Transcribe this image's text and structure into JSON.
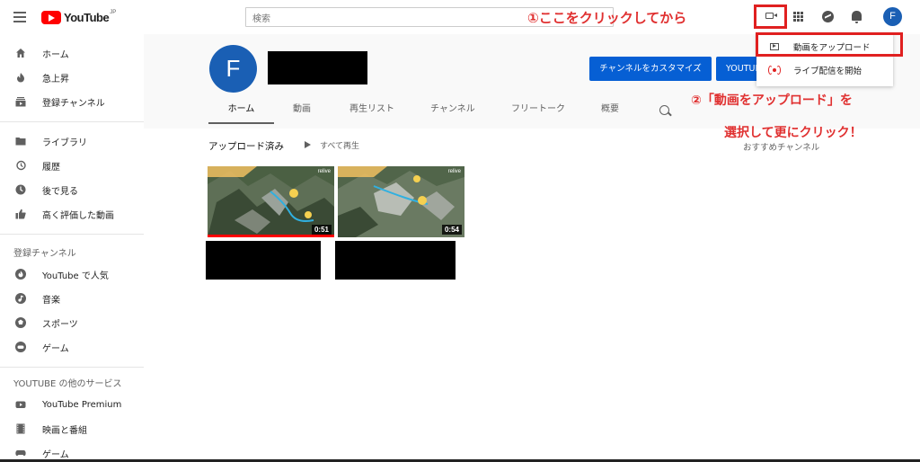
{
  "header": {
    "logo_text": "YouTube",
    "logo_region": "JP",
    "search_placeholder": "検索",
    "avatar_letter": "F",
    "annotation_step1": "①ここをクリックしてから"
  },
  "dropdown": {
    "items": [
      {
        "label": "動画をアップロード",
        "icon": "upload-video-icon"
      },
      {
        "label": "ライブ配信を開始",
        "icon": "go-live-icon"
      }
    ]
  },
  "annotation_step2": {
    "line1": "②「動画をアップロード」を",
    "line2": "選択して更にクリック！"
  },
  "sidebar": {
    "primary": [
      {
        "label": "ホーム",
        "icon": "home-icon"
      },
      {
        "label": "急上昇",
        "icon": "trending-icon"
      },
      {
        "label": "登録チャンネル",
        "icon": "subscriptions-icon"
      }
    ],
    "library": [
      {
        "label": "ライブラリ",
        "icon": "library-icon"
      },
      {
        "label": "履歴",
        "icon": "history-icon"
      },
      {
        "label": "後で見る",
        "icon": "watch-later-icon"
      },
      {
        "label": "高く評価した動画",
        "icon": "liked-icon"
      }
    ],
    "subscriptions_heading": "登録チャンネル",
    "subscriptions": [
      {
        "label": "YouTube で人気",
        "icon": "popular-icon"
      },
      {
        "label": "音楽",
        "icon": "music-icon"
      },
      {
        "label": "スポーツ",
        "icon": "sports-icon"
      },
      {
        "label": "ゲーム",
        "icon": "gaming-icon"
      }
    ],
    "more_heading": "YOUTUBE の他のサービス",
    "more": [
      {
        "label": "YouTube Premium",
        "icon": "premium-icon"
      },
      {
        "label": "映画と番組",
        "icon": "movies-icon"
      },
      {
        "label": "ゲーム",
        "icon": "gaming-icon"
      }
    ]
  },
  "channel": {
    "avatar_letter": "F",
    "customize_button": "チャンネルをカスタマイズ",
    "studio_button": "YOUTUBE",
    "tabs": [
      "ホーム",
      "動画",
      "再生リスト",
      "チャンネル",
      "フリートーク",
      "概要"
    ]
  },
  "uploads": {
    "section_title": "アップロード済み",
    "play_all": "すべて再生",
    "recommended_channels": "おすすめチャンネル",
    "videos": [
      {
        "duration": "0:51",
        "watermark": "relive",
        "watched_fraction": 1.0
      },
      {
        "duration": "0:54",
        "watermark": "relive",
        "watched_fraction": 0
      }
    ]
  },
  "colors": {
    "brand_red": "#ff0000",
    "accent_blue": "#065fd4",
    "annotation_red": "#e03030"
  }
}
